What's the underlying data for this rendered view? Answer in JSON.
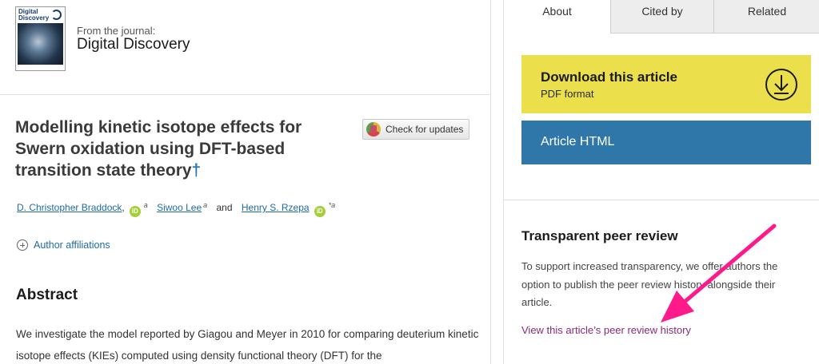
{
  "journal": {
    "cover_title": "Digital Discovery",
    "from_label": "From the journal:",
    "name": "Digital Discovery"
  },
  "article": {
    "title": "Modelling kinetic isotope effects for Swern oxidation using DFT-based transition state theory",
    "dagger": "†",
    "check_updates": "Check for updates",
    "authors": [
      {
        "name": "D. Christopher Braddock",
        "sep": ",",
        "sup": "a",
        "orcid": true
      },
      {
        "name": "Siwoo Lee",
        "sup": "a",
        "orcid": false
      },
      {
        "name": "Henry S. Rzepa",
        "sup": "*a",
        "orcid": true
      }
    ],
    "authors_and": "and",
    "orcid_label": "iD",
    "affiliations_label": "Author affiliations",
    "abstract_heading": "Abstract",
    "abstract_text": "We investigate the model reported by Giagou and Meyer in 2010 for comparing deuterium kinetic isotope effects (KIEs) computed using density functional theory (DFT) for the"
  },
  "sidebar": {
    "tabs": [
      {
        "label": "About",
        "active": true
      },
      {
        "label": "Cited by",
        "active": false
      },
      {
        "label": "Related",
        "active": false
      }
    ],
    "download": {
      "title": "Download this article",
      "subtitle": "PDF format"
    },
    "html_button": "Article HTML",
    "peer_review": {
      "heading": "Transparent peer review",
      "text": "To support increased transparency, we offer authors the option to publish the peer review history alongside their article.",
      "link": "View this article’s peer review history"
    }
  },
  "colors": {
    "download_bg": "#ebe04c",
    "html_bg": "#3077a9",
    "link": "#1f6aa5",
    "peer_link": "#8a2a7a",
    "annotation_arrow": "#ff1a8c"
  },
  "icons": {
    "download": "download-circle-icon",
    "orcid": "orcid-icon",
    "expand": "plus-circle-icon",
    "crossmark": "crossmark-icon"
  }
}
